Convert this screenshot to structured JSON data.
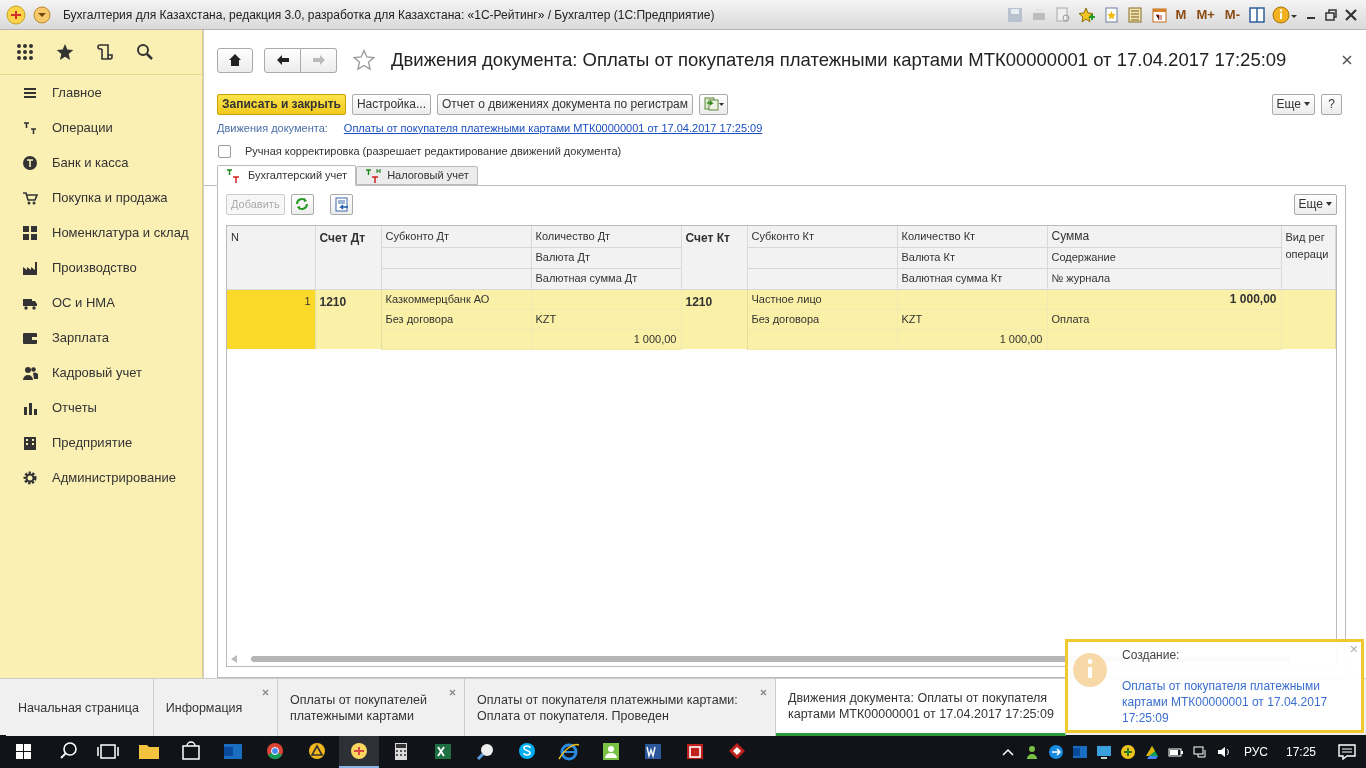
{
  "window": {
    "title": "Бухгалтерия для Казахстана, редакция 3.0, разработка для Казахстана: «1С-Рейтинг» / Бухгалтер  (1С:Предприятие)",
    "memory_buttons": [
      "M",
      "M+",
      "M-"
    ]
  },
  "sidebar": {
    "items": [
      {
        "label": "Главное"
      },
      {
        "label": "Операции"
      },
      {
        "label": "Банк и касса"
      },
      {
        "label": "Покупка и продажа"
      },
      {
        "label": "Номенклатура и склад"
      },
      {
        "label": "Производство"
      },
      {
        "label": "ОС и НМА"
      },
      {
        "label": "Зарплата"
      },
      {
        "label": "Кадровый учет"
      },
      {
        "label": "Отчеты"
      },
      {
        "label": "Предприятие"
      },
      {
        "label": "Администрирование"
      }
    ]
  },
  "form": {
    "title": "Движения документа: Оплаты от покупателя платежными картами МТК00000001 от 17.04.2017 17:25:09",
    "buttons": [
      {
        "label": "Записать и закрыть",
        "kind": "primary"
      },
      {
        "label": "Настройка...",
        "kind": "normal"
      },
      {
        "label": "Отчет о движениях документа по регистрам",
        "kind": "normal"
      }
    ],
    "more_button": "Еще",
    "help_button": "?",
    "document_label": "Движения документа:",
    "document_link": "Оплаты от покупателя платежными картами МТК00000001 от 17.04.2017 17:25:09",
    "manual_edit": {
      "label": "Ручная корректировка (разрешает редактирование движений документа)",
      "checked": false
    },
    "tabs": [
      {
        "label": "Бухгалтерский учет",
        "selected": true
      },
      {
        "label": "Налоговый учет",
        "selected": false
      }
    ],
    "table_toolbar": {
      "add_button": {
        "label": "Добавить",
        "disabled": true
      },
      "more_button": "Еще"
    },
    "table": {
      "columns": [
        {
          "kind": "number",
          "lines": [
            "N"
          ],
          "bold": false
        },
        {
          "kind": "account",
          "lines": [
            "Счет Дт"
          ],
          "bold": true
        },
        {
          "kind": "text",
          "top": "Субконто Дт",
          "bold": false
        },
        {
          "kind": "amount",
          "top": "Количество Дт",
          "middle": "Валюта Дт",
          "bottom": "Валютная сумма Дт",
          "bold": false
        },
        {
          "kind": "account",
          "lines": [
            "Счет Кт"
          ],
          "bold": true
        },
        {
          "kind": "text",
          "top": "Субконто Кт",
          "bold": false
        },
        {
          "kind": "amount",
          "top": "Количество Кт",
          "middle": "Валюта Кт",
          "bottom": "Валютная сумма Кт",
          "bold": false
        },
        {
          "kind": "amount",
          "top": "Сумма",
          "middle": "Содержание",
          "bottom": "№ журнала",
          "bold": true
        },
        {
          "kind": "text",
          "lines": [
            "Вид рег",
            "операци"
          ],
          "bold": false
        }
      ],
      "rows": [
        {
          "selected": true,
          "cells": [
            {
              "text": "1"
            },
            {
              "text": "1210"
            },
            {
              "top": "Казкоммерцбанк АО",
              "middle": "Без договора"
            },
            {
              "middle": "KZT",
              "bottom": "1 000,00"
            },
            {
              "text": "1210"
            },
            {
              "top": "Частное лицо",
              "middle": "Без договора"
            },
            {
              "middle": "KZT",
              "bottom": "1 000,00"
            },
            {
              "top": "1 000,00",
              "middle": "Оплата"
            }
          ]
        }
      ]
    }
  },
  "open_tabs": [
    {
      "lines": [
        "Начальная страница"
      ],
      "closable": false,
      "selected": false
    },
    {
      "lines": [
        "Информация"
      ],
      "closable": true,
      "selected": false
    },
    {
      "lines": [
        "Оплаты от покупателей",
        "платежными картами"
      ],
      "closable": true,
      "selected": false
    },
    {
      "lines": [
        "Оплаты от покупателя платежными картами:",
        "Оплата от покупателя. Проведен"
      ],
      "closable": true,
      "selected": false
    },
    {
      "lines": [
        "Движения документа: Оплаты от покупателя",
        "картами МТК00000001 от 17.04.2017 17:25:09"
      ],
      "closable": false,
      "selected": true
    }
  ],
  "notification": {
    "title": "Создание:",
    "link": "Оплаты от покупателя платежными картами МТК00000001 от 17.04.2017 17:25:09",
    "close": "×"
  },
  "taskbar": {
    "language": "РУС",
    "time": "17:25"
  }
}
